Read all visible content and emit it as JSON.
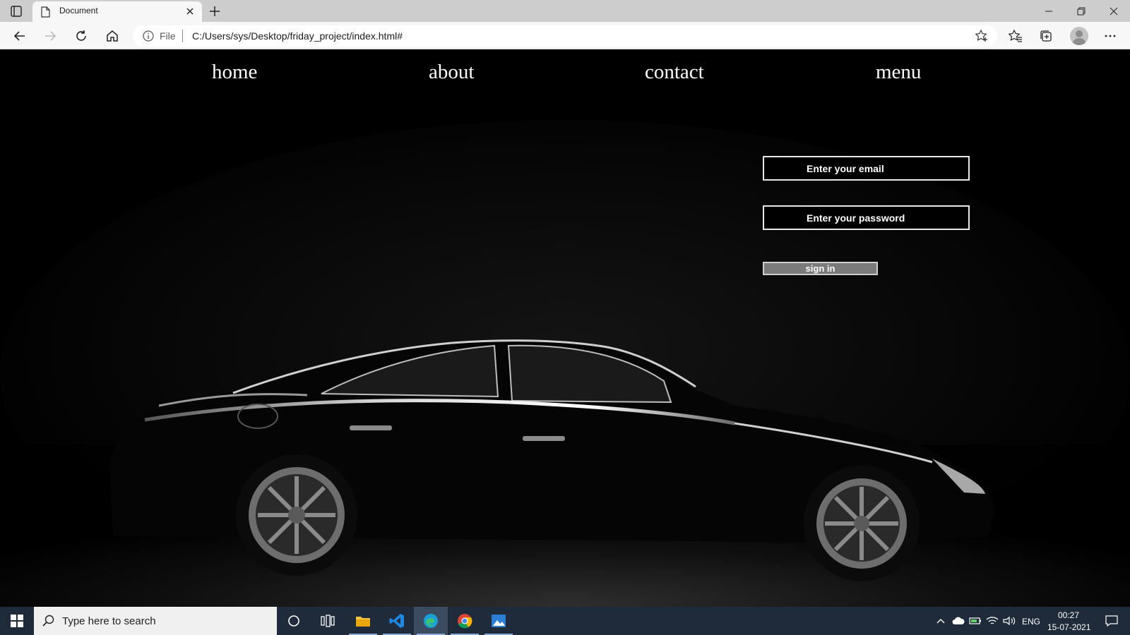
{
  "browser": {
    "tab_title": "Document",
    "address_prefix": "File",
    "url": "C:/Users/sys/Desktop/friday_project/index.html#",
    "icons": [
      "tab-actions-icon",
      "document-icon",
      "close-icon",
      "plus-icon",
      "minimize-icon",
      "restore-icon",
      "window-close-icon",
      "back-icon",
      "forward-icon",
      "refresh-icon",
      "home-icon",
      "info-icon",
      "add-favorite-icon",
      "favorites-icon",
      "collections-icon",
      "profile-icon",
      "more-icon"
    ]
  },
  "page": {
    "nav": [
      "home",
      "about",
      "contact",
      "menu"
    ],
    "email_placeholder": "Enter your email",
    "password_placeholder": "Enter your password",
    "signin_label": "sign in"
  },
  "taskbar": {
    "search_placeholder": "Type here to search",
    "language": "ENG",
    "time": "00:27",
    "date": "15-07-2021",
    "apps": [
      "file-explorer-icon",
      "vscode-icon",
      "edge-icon",
      "chrome-icon",
      "photos-icon"
    ]
  },
  "colors": {
    "page_background": "#000000",
    "taskbar_background": "#1f2a3a",
    "button_gray": "#7b7b7b"
  }
}
